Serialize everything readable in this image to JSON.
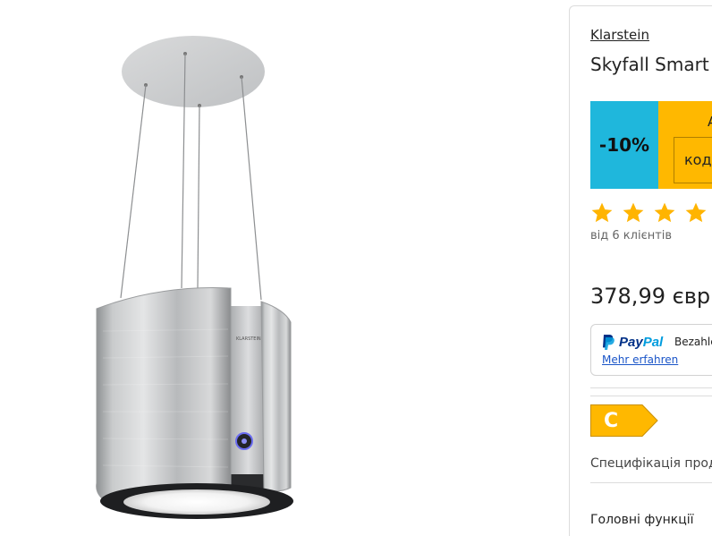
{
  "product": {
    "brand": "Klarstein",
    "title": "Skyfall Smart",
    "image_brand_text": "KLARSTEIN"
  },
  "promo": {
    "discount": "-10%",
    "top_text": "А",
    "code_label": "код"
  },
  "rating": {
    "stars_visible": 4,
    "reviews_text": "від 6 клієнтів"
  },
  "price": {
    "text": "378,99 євр"
  },
  "paypal": {
    "logo_text_pay": "Pay",
    "logo_text_pal": "Pal",
    "text": "Bezahle",
    "link": "Mehr erfahren"
  },
  "energy": {
    "class": "C"
  },
  "spec_text": "Специфікація прод",
  "features_heading": "Головні функції",
  "colors": {
    "discount_bg": "#1fb7dc",
    "promo_bg": "#ffb800",
    "star": "#ffb400",
    "energy": "#ffb800"
  }
}
